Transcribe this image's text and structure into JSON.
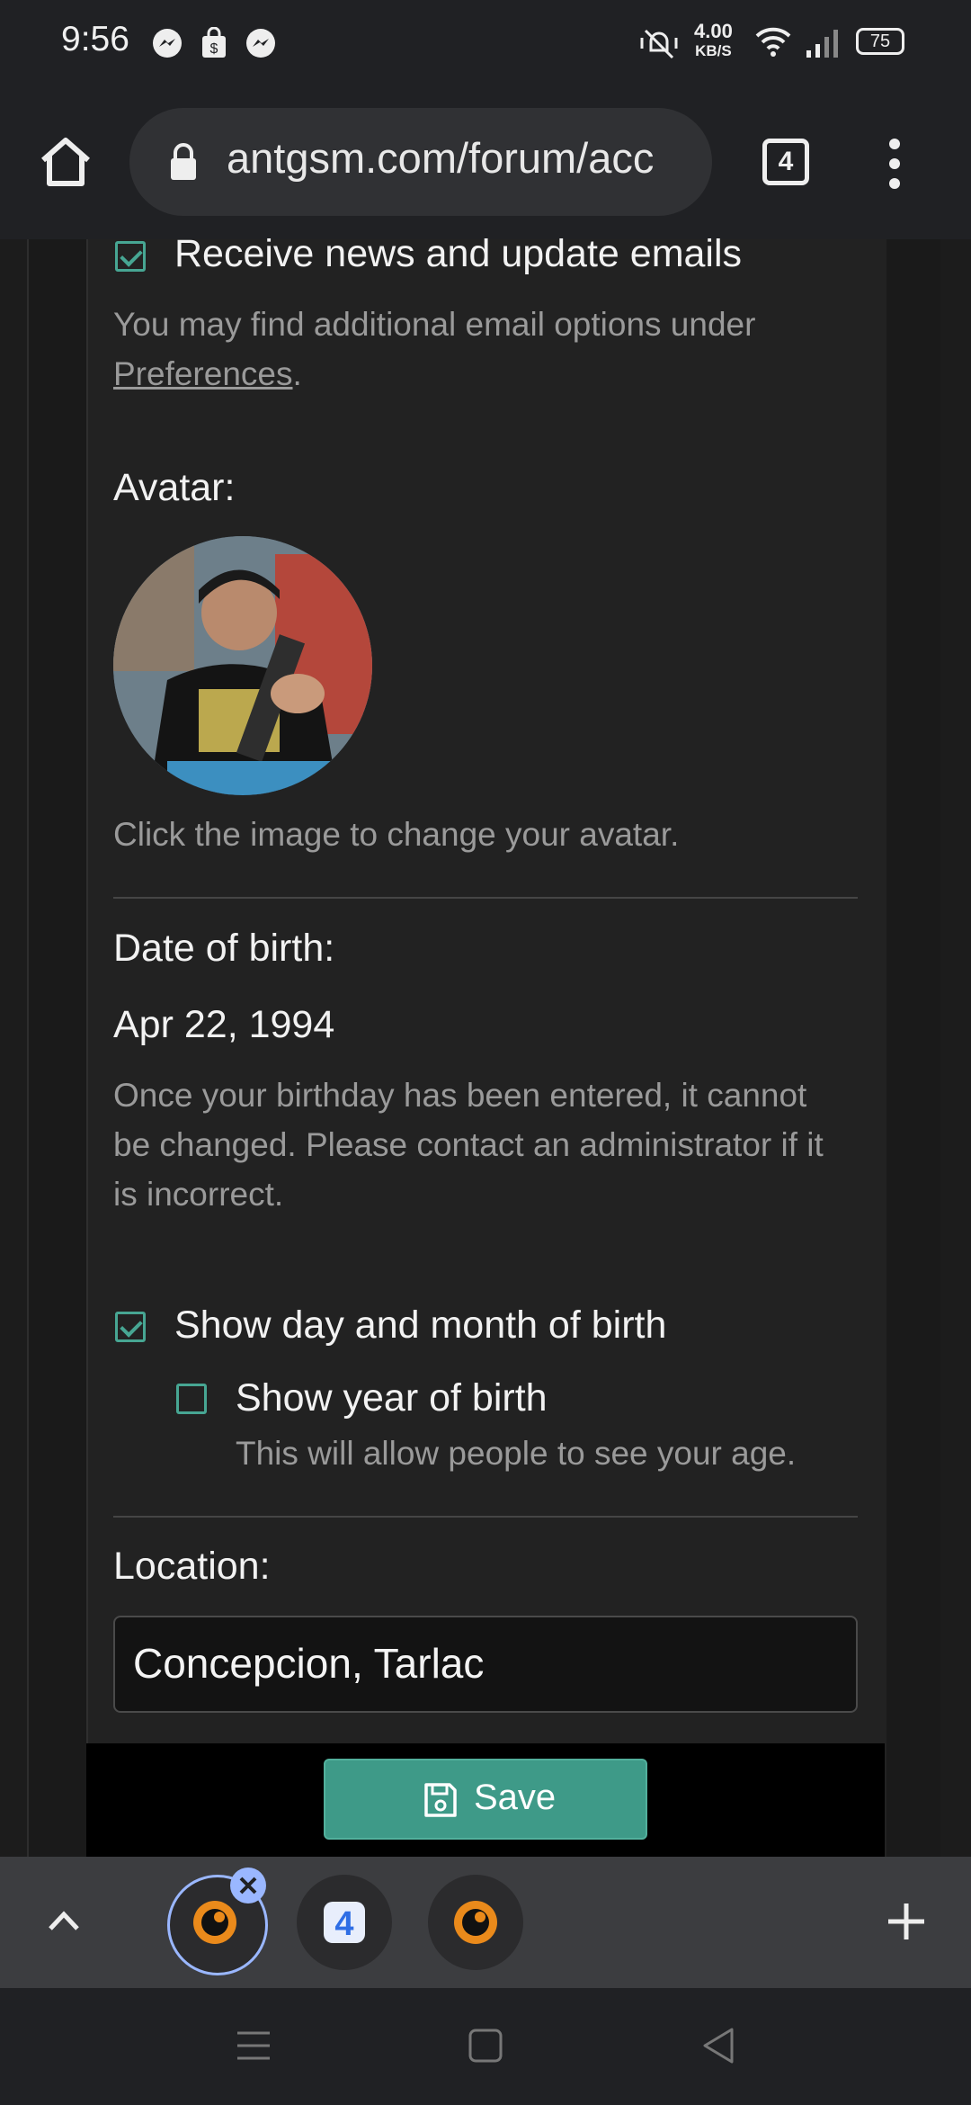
{
  "status_bar": {
    "time": "9:56",
    "net_speed_value": "4.00",
    "net_speed_unit": "KB/S",
    "battery": "75",
    "notification_icons": [
      "messenger-icon",
      "shopping-bag-icon",
      "messenger-icon"
    ],
    "system_icons": [
      "vibrate-off-icon",
      "wifi-icon",
      "signal-icon",
      "battery-icon"
    ]
  },
  "browser": {
    "url": "antgsm.com/forum/acc",
    "tab_count": "4"
  },
  "form": {
    "news_emails": {
      "label": "Receive news and update emails",
      "checked": true
    },
    "email_hint_text": "You may find additional email options under ",
    "email_hint_link": "Preferences",
    "email_hint_end": ".",
    "avatar_label": "Avatar:",
    "avatar_hint": "Click the image to change your avatar.",
    "dob_label": "Date of birth:",
    "dob_value": "Apr 22, 1994",
    "dob_hint": "Once your birthday has been entered, it cannot be changed. Please contact an administrator if it is incorrect.",
    "show_day_month": {
      "label": "Show day and month of birth",
      "checked": true
    },
    "show_year": {
      "label": "Show year of birth",
      "checked": false,
      "hint": "This will allow people to see your age."
    },
    "location_label": "Location:",
    "location_value": "Concepcion, Tarlac",
    "save_label": "Save"
  },
  "tab_strip": {
    "tabs": [
      "tab-1",
      "tab-2",
      "tab-3"
    ],
    "selected_tab": 1
  },
  "colors": {
    "accent": "#47a693",
    "save_button": "#3e9a88",
    "background": "#1c1c1c"
  }
}
